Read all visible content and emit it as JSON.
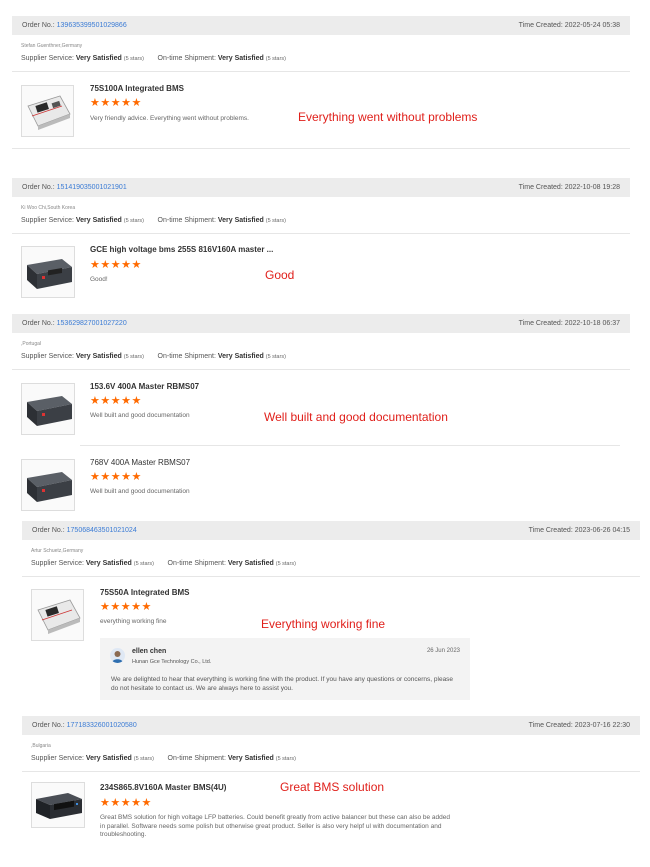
{
  "labels": {
    "order_no": "Order No.:",
    "time_created": "Time Created:",
    "supplier_service": "Supplier Service:",
    "ontime_shipment": "On-time Shipment:",
    "five_stars_text": "(5 stars)"
  },
  "orders": [
    {
      "order_no": "139635399501029866",
      "time": "2022-05-24 05:38",
      "buyer": "Stefan Guenthner,Germany",
      "supplier_rating": "Very Satisfied",
      "shipment_rating": "Very Satisfied",
      "items": [
        {
          "product": "75S100A Integrated BMS",
          "stars": "★★★★★",
          "rating": 5,
          "review": "Very friendly advice.  Everything went without problems.",
          "annotation": "Everything went without problems",
          "thumb": "white-board-bms"
        }
      ]
    },
    {
      "order_no": "151419035001021901",
      "time": "2022-10-08 19:28",
      "buyer": "Ki Woo Chi,South Korea",
      "supplier_rating": "Very Satisfied",
      "shipment_rating": "Very Satisfied",
      "items": [
        {
          "product": "GCE high voltage bms 255S 816V160A master ...",
          "stars": "★★★★★",
          "rating": 5,
          "review": "Good!",
          "annotation": "Good",
          "thumb": "black-box-bms"
        }
      ]
    },
    {
      "order_no": "153629827001027220",
      "time": "2022-10-18 06:37",
      "buyer": ",Portugal",
      "supplier_rating": "Very Satisfied",
      "shipment_rating": "Very Satisfied",
      "items": [
        {
          "product": "153.6V 400A Master RBMS07",
          "stars": "★★★★★",
          "rating": 5,
          "review": "Well built and good documentation",
          "annotation": "Well built and good documentation",
          "thumb": "black-box-bms"
        },
        {
          "product": "768V 400A Master RBMS07",
          "stars": "★★★★★",
          "rating": 5,
          "review": "Well built and good documentation",
          "annotation": "",
          "thumb": "black-box-bms"
        }
      ]
    },
    {
      "order_no": "175068463501021024",
      "time": "2023-06-26 04:15",
      "buyer": "Artur Schuetz,Germany",
      "supplier_rating": "Very Satisfied",
      "shipment_rating": "Very Satisfied",
      "items": [
        {
          "product": "75S50A Integrated BMS",
          "stars": "★★★★★",
          "rating": 5,
          "review": "everything working fine",
          "annotation": "Everything working fine",
          "thumb": "white-board-bms"
        }
      ],
      "reply": {
        "name": "ellen chen",
        "company": "Hunan Gce Technology Co., Ltd.",
        "date": "26 Jun 2023",
        "text": "We are delighted to hear that everything is working fine with the product. If you have any questions or concerns, please do not hesitate to contact us. We are always here to assist you."
      }
    },
    {
      "order_no": "177183326001020580",
      "time": "2023-07-16 22:30",
      "buyer": ",Bulgaria",
      "supplier_rating": "Very Satisfied",
      "shipment_rating": "Very Satisfied",
      "items": [
        {
          "product": "234S865.8V160A Master BMS(4U)",
          "stars": "★★★★★",
          "rating": 5,
          "review": "Great BMS solution for high voltage LFP batteries. Could benefit greatly from active balancer but these can also be added in parallel. Software needs some polish but otherwise great product. Seller is also very helpf ul with documentation and troubleshooting.",
          "annotation": "Great BMS solution",
          "thumb": "rack-bms"
        }
      ]
    }
  ],
  "colors": {
    "link": "#3a7bd5",
    "star": "#ff6a00",
    "annotation": "#e0201b",
    "header_bg": "#ececec"
  }
}
